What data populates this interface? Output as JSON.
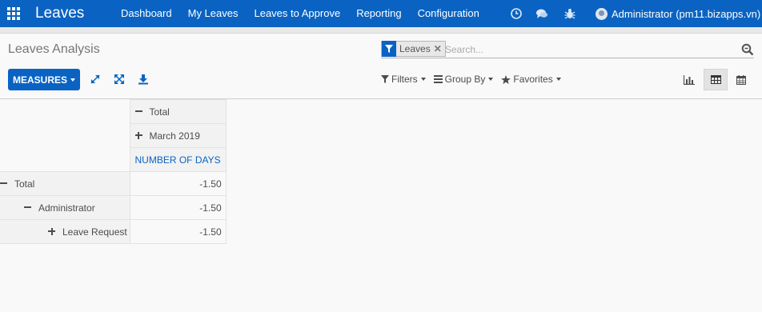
{
  "nav": {
    "brand": "Leaves",
    "menu": [
      "Dashboard",
      "My Leaves",
      "Leaves to Approve",
      "Reporting",
      "Configuration"
    ],
    "user": "Administrator (pm11.bizapps.vn)",
    "icons": [
      "clock-icon",
      "chat-icon",
      "bug-icon"
    ]
  },
  "page": {
    "breadcrumb": "Leaves Analysis"
  },
  "search": {
    "facet": "Leaves",
    "placeholder": "Search..."
  },
  "toolbar": {
    "measures_label": "MEASURES",
    "filters_label": "Filters",
    "groupby_label": "Group By",
    "favorites_label": "Favorites",
    "active_view": "pivot"
  },
  "pivot": {
    "col_total": "Total",
    "col_group": "March 2019",
    "measure": "NUMBER OF DAYS",
    "rows": [
      {
        "label": "Total",
        "value": "-1.50",
        "expander": "minus"
      },
      {
        "label": "Administrator",
        "value": "-1.50",
        "expander": "minus"
      },
      {
        "label": "Leave Request",
        "value": "-1.50",
        "expander": "plus"
      }
    ]
  },
  "colors": {
    "primary": "#0a63c2"
  }
}
